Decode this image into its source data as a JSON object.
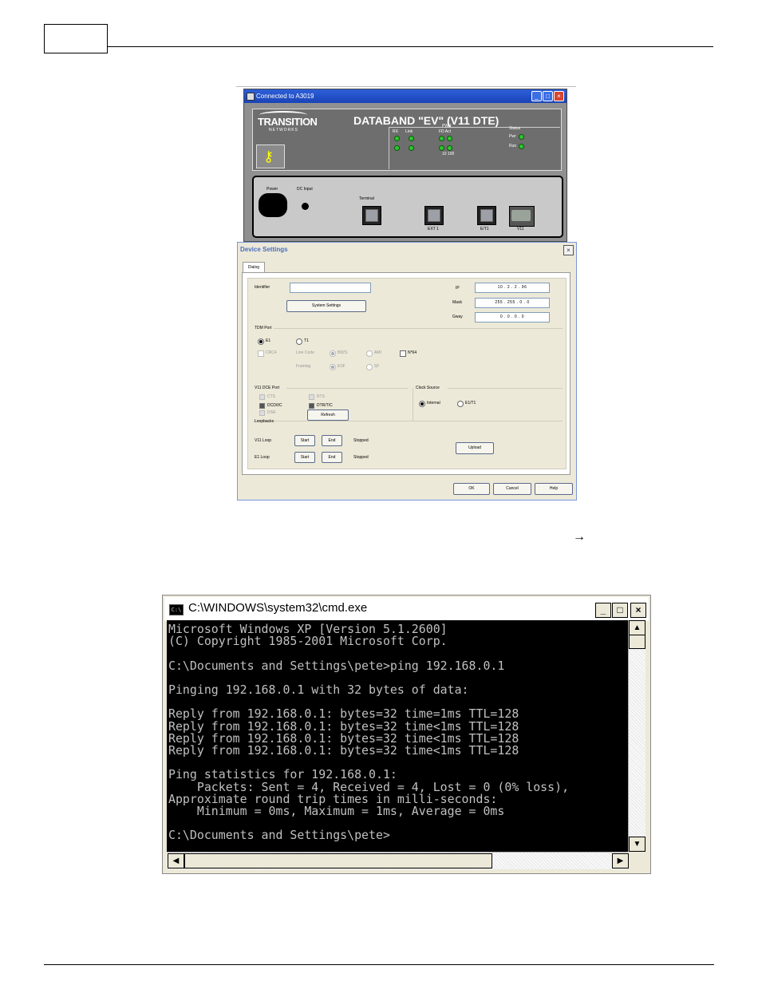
{
  "page": {
    "arrow_glyph": "→"
  },
  "device_window": {
    "title": "Connected to A3019",
    "logo_main": "TRANSITION",
    "logo_sub": "NETWORKS",
    "device_title": "DATABAND \"EV\" (V11 DTE)",
    "led_labels": {
      "rx": "RX",
      "col": "Link",
      "pwr": "PWR",
      "fd": "FD Act",
      "ten": "10 100",
      "status": "Status",
      "pwr1": "Pwr",
      "run": "Run"
    },
    "port_labels": {
      "power": "Power",
      "dc_input": "DC Input",
      "terminal": "Terminal",
      "ext": "EXT 1",
      "e1": "E/T1",
      "v11": "V11"
    }
  },
  "device_settings": {
    "title": "Device Settings",
    "tab_label": "Dialog",
    "identifier_label": "Identifier",
    "identifier_value": "",
    "system_settings_button": "System Settings",
    "ip_label": "IP",
    "ip_value": "10 .  2  .  2  . 96",
    "mask_label": "Mask",
    "mask_value": "255 . 255 .  0  .  0",
    "gway_label": "Gway",
    "gway_value": "0  .  0  .  0  .  0",
    "tdm_port": {
      "label": "TDM Port",
      "e1": "E1",
      "t1": "T1",
      "crc4": "CRC4",
      "line_code": "Line Code",
      "b8zs": "B8ZS",
      "ami": "AMI",
      "framing": "Framing",
      "esf": "ESF",
      "sf": "SF",
      "n64": "N*64"
    },
    "v11_port": {
      "label": "V11 DCE Port",
      "cts": "CTS",
      "dcd": "DCD/I/C",
      "dsr": "DSR",
      "rts": "RTS",
      "dtr": "DTR/T/C",
      "refresh": "Refresh"
    },
    "clock_source": {
      "label": "Clock Source",
      "internal": "Internal",
      "e1t1": "E1/T1"
    },
    "loopbacks": {
      "label": "Loopbacks",
      "v11_loop": "V11 Loop",
      "e1_loop": "E1 Loop",
      "start": "Start",
      "end": "End",
      "status_v11": "Stopped",
      "status_e1": "Stopped",
      "upload": "Upload"
    },
    "buttons": {
      "ok": "OK",
      "cancel": "Cancel",
      "help": "Help"
    }
  },
  "cmd_window": {
    "title": "C:\\WINDOWS\\system32\\cmd.exe",
    "icon_text": "C:\\",
    "lines": [
      "Microsoft Windows XP [Version 5.1.2600]",
      "(C) Copyright 1985-2001 Microsoft Corp.",
      "",
      "C:\\Documents and Settings\\pete>ping 192.168.0.1",
      "",
      "Pinging 192.168.0.1 with 32 bytes of data:",
      "",
      "Reply from 192.168.0.1: bytes=32 time=1ms TTL=128",
      "Reply from 192.168.0.1: bytes=32 time<1ms TTL=128",
      "Reply from 192.168.0.1: bytes=32 time<1ms TTL=128",
      "Reply from 192.168.0.1: bytes=32 time<1ms TTL=128",
      "",
      "Ping statistics for 192.168.0.1:",
      "    Packets: Sent = 4, Received = 4, Lost = 0 (0% loss),",
      "Approximate round trip times in milli-seconds:",
      "    Minimum = 0ms, Maximum = 1ms, Average = 0ms",
      "",
      "C:\\Documents and Settings\\pete>"
    ]
  }
}
